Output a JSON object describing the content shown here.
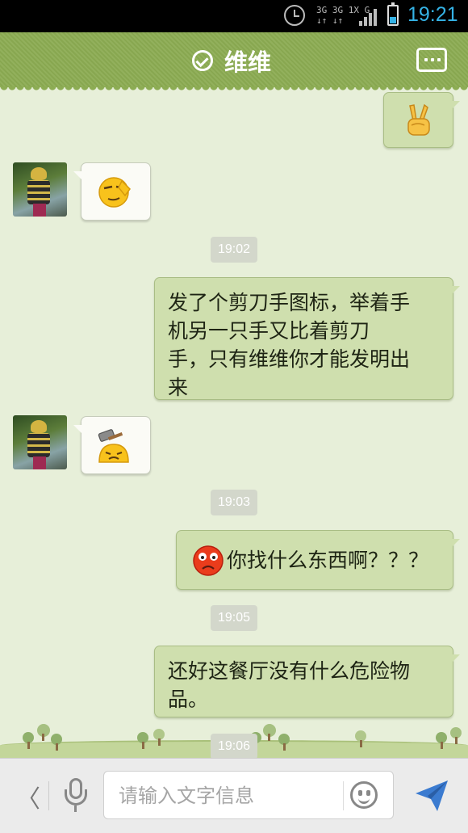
{
  "status_bar": {
    "network_top": "3G 3G 1X G",
    "network_bottom": "↓↑ ↓↑",
    "time": "19:21"
  },
  "header": {
    "title": "维维",
    "status_icon": "check-circle-icon",
    "menu_icon": "more-dots-icon"
  },
  "messages": [
    {
      "direction": "out",
      "type": "emoji",
      "emoji": "victory-hand-emoji"
    },
    {
      "direction": "in",
      "type": "emoji",
      "emoji": "salute-face-emoji"
    },
    {
      "type": "timestamp",
      "text": "19:02"
    },
    {
      "direction": "out",
      "type": "text",
      "lines": [
        "发了个剪刀手图标，举着手",
        "机另一只手又比着剪刀",
        "手，只有维维你才能发明出",
        "来"
      ]
    },
    {
      "direction": "in",
      "type": "emoji",
      "emoji": "hammer-head-face-emoji"
    },
    {
      "type": "timestamp",
      "text": "19:03"
    },
    {
      "direction": "out",
      "type": "emoji_text",
      "emoji": "scared-face-emoji",
      "text": "你找什么东西啊？？？"
    },
    {
      "type": "timestamp",
      "text": "19:05"
    },
    {
      "direction": "out",
      "type": "text",
      "lines": [
        "还好这餐厅没有什么危险物",
        "品。"
      ]
    },
    {
      "type": "timestamp",
      "text": "19:06"
    }
  ],
  "input_bar": {
    "back_label": "〈",
    "placeholder": "请输入文字信息",
    "value": ""
  },
  "colors": {
    "header": "#8cac53",
    "background": "#e7efd9",
    "outgoing_bubble": "#cfdfae",
    "incoming_bubble": "#fbfbf6",
    "accent": "#35b3e6"
  }
}
